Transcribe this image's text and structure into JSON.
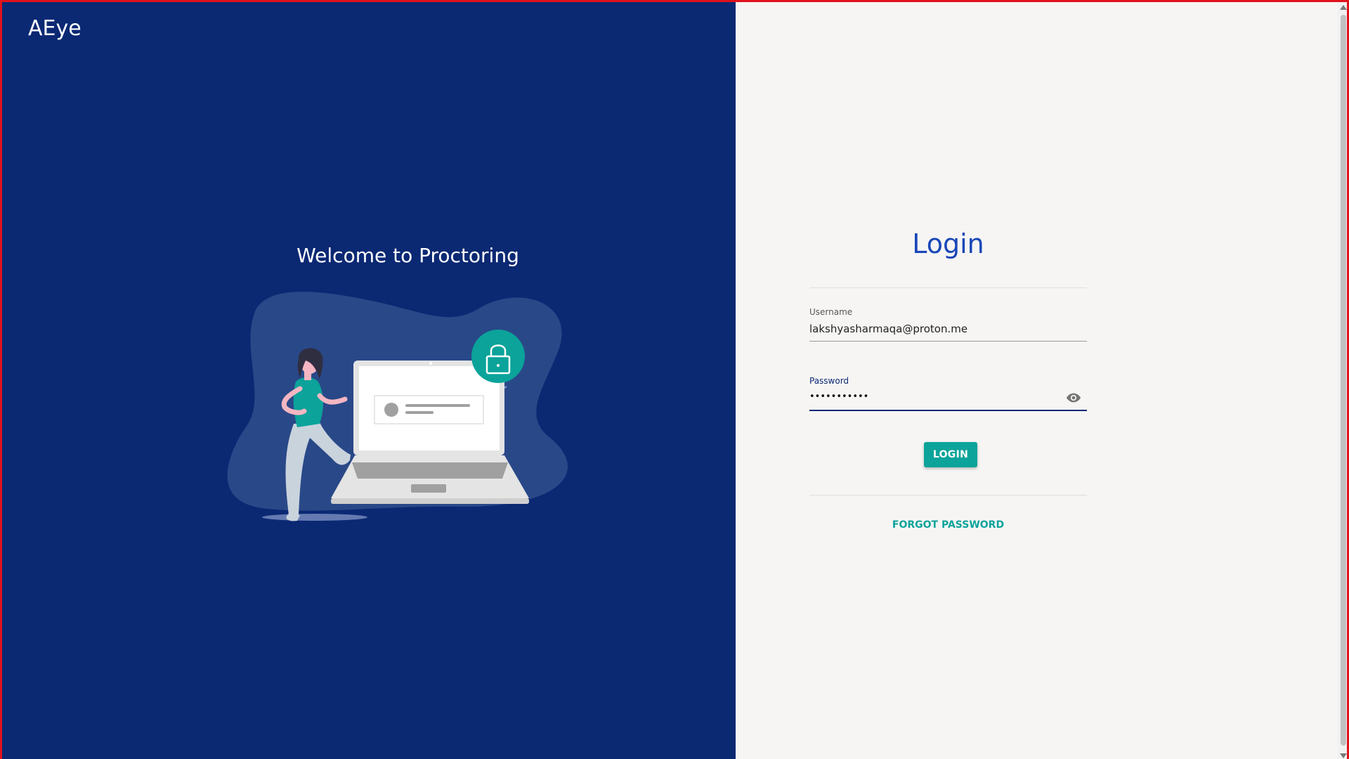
{
  "brand": {
    "name": "AEye"
  },
  "left_panel": {
    "welcome_text": "Welcome to Proctoring",
    "illustration": "person-with-laptop-and-lock-illustration"
  },
  "login_form": {
    "title": "Login",
    "username": {
      "label": "Username",
      "value": "lakshyasharmaqa@proton.me"
    },
    "password": {
      "label": "Password",
      "masked_value": "•••••••••••",
      "toggle_icon": "eye-icon"
    },
    "login_button_label": "LOGIN",
    "forgot_password_label": "FORGOT PASSWORD"
  },
  "colors": {
    "left_background": "#0b2873",
    "right_background": "#f6f5f4",
    "title_blue": "#1a47b8",
    "accent_teal": "#0ba39a"
  }
}
